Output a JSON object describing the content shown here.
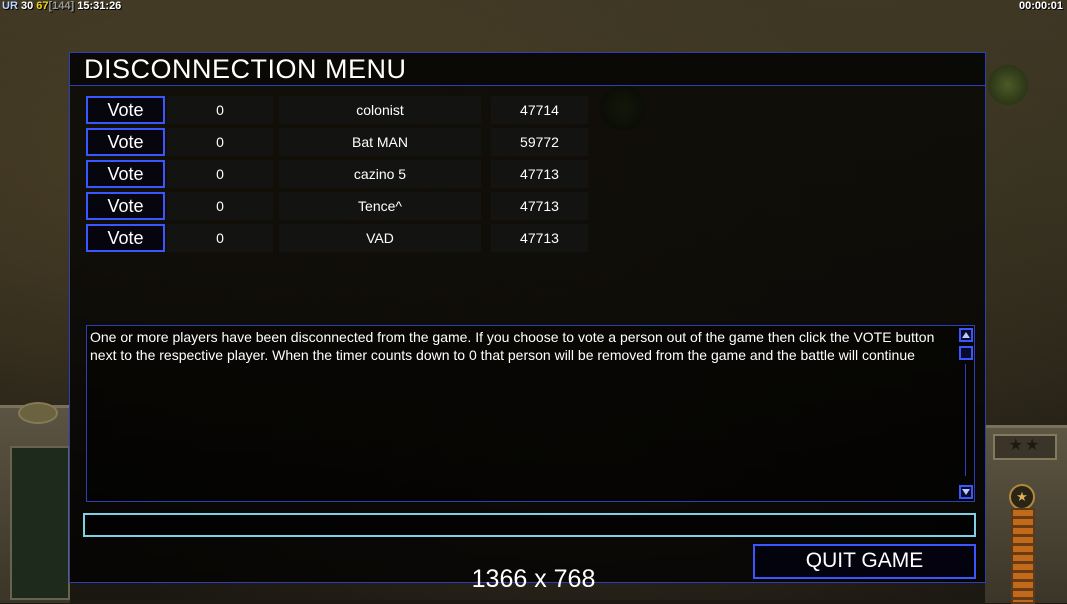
{
  "status_bar": {
    "ur_label": "UR",
    "ur_value": "30",
    "lag_value": "67",
    "sub_value": "[144]",
    "clock": "15:31:26",
    "elapsed": "00:00:01"
  },
  "menu": {
    "title": "DISCONNECTION MENU",
    "players": [
      {
        "vote_label": "Vote",
        "votes": "0",
        "name": "colonist",
        "ping": "47714"
      },
      {
        "vote_label": "Vote",
        "votes": "0",
        "name": "Bat MAN",
        "ping": "59772"
      },
      {
        "vote_label": "Vote",
        "votes": "0",
        "name": "cazino 5",
        "ping": "47713"
      },
      {
        "vote_label": "Vote",
        "votes": "0",
        "name": "Tence^",
        "ping": "47713"
      },
      {
        "vote_label": "Vote",
        "votes": "0",
        "name": "VAD",
        "ping": "47713"
      }
    ],
    "message": "One or more players have been disconnected from the game. If you choose to vote a person out of the game then click the VOTE button next to the respective player. When the timer counts down to 0 that person will be removed from the game and the battle will continue",
    "chat_value": "",
    "quit_label": "QUIT GAME"
  },
  "overlay": {
    "resolution": "1366 x 768"
  },
  "colors": {
    "border_blue": "#2d3fb8",
    "button_blue": "#3a56ff",
    "input_cyan": "#7fd0e6",
    "lag_yellow": "#f2d21e"
  }
}
